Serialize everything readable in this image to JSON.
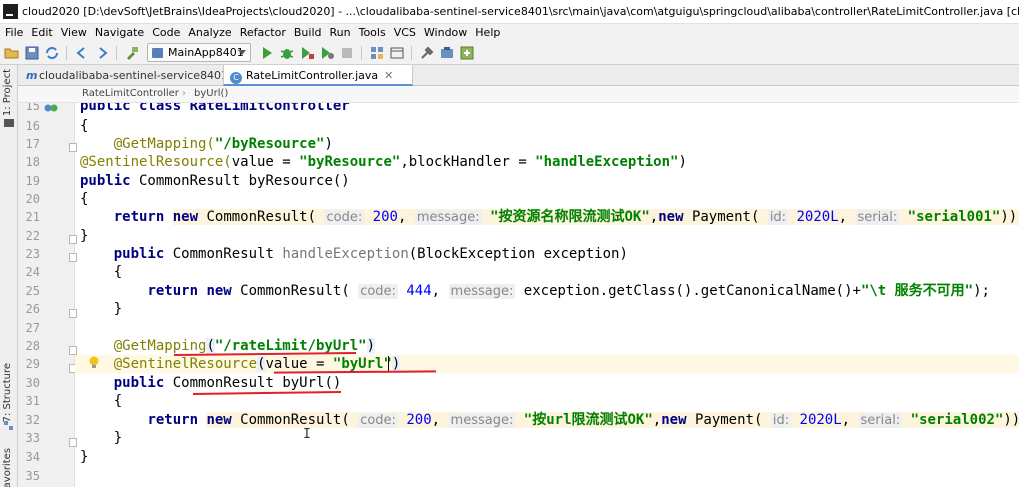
{
  "window": {
    "title": "cloud2020 [D:\\devSoft\\JetBrains\\IdeaProjects\\cloud2020] - ...\\cloudalibaba-sentinel-service8401\\src\\main\\java\\com\\atguigu\\springcloud\\alibaba\\controller\\RateLimitController.java [cloudalibaba-sentinel-se..."
  },
  "menu": [
    "File",
    "Edit",
    "View",
    "Navigate",
    "Code",
    "Analyze",
    "Refactor",
    "Build",
    "Run",
    "Tools",
    "VCS",
    "Window",
    "Help"
  ],
  "toolbar": {
    "run_config": "MainApp8401"
  },
  "side_tabs": {
    "project": "1: Project",
    "structure": "7: Structure",
    "favorites": "avorites"
  },
  "tabs": [
    {
      "label": "cloudalibaba-sentinel-service8401",
      "icon": "m"
    },
    {
      "label": "RateLimitController.java",
      "icon": "C"
    }
  ],
  "breadcrumb": [
    "RateLimitController",
    "byUrl()"
  ],
  "gutter": {
    "line_numbers": [
      "15",
      "16",
      "17",
      "18",
      "19",
      "20",
      "21",
      "22",
      "23",
      "24",
      "25",
      "26",
      "27",
      "28",
      "29",
      "30",
      "31",
      "32",
      "33",
      "34",
      "35"
    ]
  },
  "code": {
    "l15": "public class RateLimitController",
    "l16": "{",
    "l17_ann": "@GetMapping(",
    "l17_str": "\"/byResource\"",
    "l17_end": ")",
    "l18_ann": "@SentinelResource(",
    "l18_a": "value = ",
    "l18_s1": "\"byResource\"",
    "l18_b": ",blockHandler = ",
    "l18_s2": "\"handleException\"",
    "l18_end": ")",
    "l19_kw": "public",
    "l19_rest": " CommonResult byResource()",
    "l20": "{",
    "l21_ret": "return",
    "l21_new": "new",
    "l21_cls": " CommonResult(",
    "l21_h1": "code:",
    "l21_n1": "200",
    "l21_h2": "message:",
    "l21_s1": "\"按资源名称限流测试OK\"",
    "l21_new2": "new",
    "l21_cls2": " Payment(",
    "l21_h3": "id:",
    "l21_n2": "2020L",
    "l21_h4": "serial:",
    "l21_s2": "\"serial001\"",
    "l21_end": "));",
    "l22": "}",
    "l23_kw": "public",
    "l23_a": " CommonResult ",
    "l23_m": "handleException",
    "l23_b": "(BlockException exception)",
    "l24": "{",
    "l25_ret": "return",
    "l25_new": "new",
    "l25_cls": " CommonResult(",
    "l25_h1": "code:",
    "l25_n1": "444",
    "l25_h2": "message:",
    "l25_a": "exception.getClass().getCanonicalName()+",
    "l25_s": "\"\\t 服务不可用\"",
    "l25_end": ");",
    "l26": "}",
    "l28_ann": "@GetMapping",
    "l28_p": "(",
    "l28_str": "\"/rateLimit/byUrl\"",
    "l28_end": ")",
    "l29_ann": "@SentinelResource",
    "l29_p": "(",
    "l29_a": "value = ",
    "l29_s": "\"byUrl\"",
    "l29_end": ")",
    "l30_kw": "public",
    "l30_a": " CommonResult ",
    "l30_m": "byUrl",
    "l30_end": "()",
    "l31": "{",
    "l32_ret": "return",
    "l32_new": "new",
    "l32_cls": " CommonResult(",
    "l32_h1": "code:",
    "l32_n1": "200",
    "l32_h2": "message:",
    "l32_s1": "\"按url限流测试OK\"",
    "l32_new2": "new",
    "l32_cls2": " Payment(",
    "l32_h3": "id:",
    "l32_n2": "2020L",
    "l32_h4": "serial:",
    "l32_s2": "\"serial002\"",
    "l32_end": "));",
    "l33": "}",
    "l34": "}",
    "ibeam": "I"
  },
  "colors": {
    "keyword": "#000080",
    "string": "#008000",
    "annotation": "#808000",
    "number": "#0000ff",
    "underline": "#e0202a"
  },
  "icons": [
    "app-icon",
    "open-folder-icon",
    "save-icon",
    "sync-icon",
    "back-icon",
    "forward-icon",
    "build-icon",
    "run-icon",
    "debug-icon",
    "run-coverage-icon",
    "stop-icon",
    "project-structure-icon",
    "settings-icon",
    "sdk-icon",
    "bulb-icon"
  ]
}
